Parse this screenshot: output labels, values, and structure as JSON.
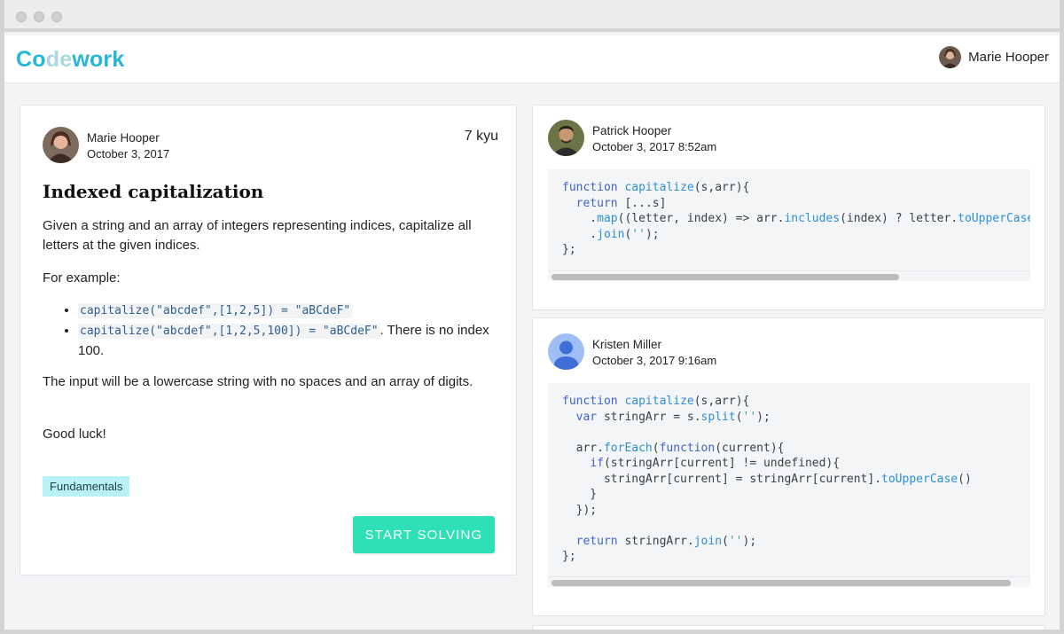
{
  "app": {
    "logo": {
      "part1": "Co",
      "part2": "de",
      "part3": "work"
    },
    "user_name": "Marie Hooper"
  },
  "kata": {
    "author": "Marie Hooper",
    "date": "October 3, 2017",
    "rank": "7 kyu",
    "title": "Indexed capitalization",
    "intro": "Given a string and an array of integers representing indices, capitalize all letters at the given indices.",
    "example_label": "For example:",
    "examples": [
      {
        "code": "capitalize(\"abcdef\",[1,2,5]) = \"aBCdeF\"",
        "note": ""
      },
      {
        "code": "capitalize(\"abcdef\",[1,2,5,100]) = \"aBCdeF\"",
        "note": ". There is no index 100."
      }
    ],
    "input_note": "The input will be a lowercase string with no spaces and an array of digits.",
    "closing": "Good luck!",
    "tag": "Fundamentals",
    "start_button": "START SOLVING"
  },
  "solutions": [
    {
      "author": "Patrick Hooper",
      "date": "October 3, 2017 8:52am",
      "code_lines": [
        "function capitalize(s,arr){",
        "  return [...s]",
        "    .map((letter, index) => arr.includes(index) ? letter.toUpperCase() : letter)",
        "    .join('');",
        "};"
      ],
      "scroll_fraction": 0.72
    },
    {
      "author": "Kristen Miller",
      "date": "October 3, 2017 9:16am",
      "code_lines": [
        "function capitalize(s,arr){",
        "  var stringArr = s.split('');",
        "",
        "  arr.forEach(function(current){",
        "    if(stringArr[current] != undefined){",
        "      stringArr[current] = stringArr[current].toUpperCase()",
        "    }",
        "  });",
        "",
        "  return stringArr.join('');",
        "};"
      ],
      "scroll_fraction": 0.96
    }
  ],
  "colors": {
    "accent": "#26b7d3",
    "button": "#2ee0b5",
    "tag_bg": "#b8f1f6",
    "code_keyword": "#3f63c8",
    "code_function": "#2d8fd6"
  },
  "icons": {
    "default_avatar": "person-icon"
  }
}
